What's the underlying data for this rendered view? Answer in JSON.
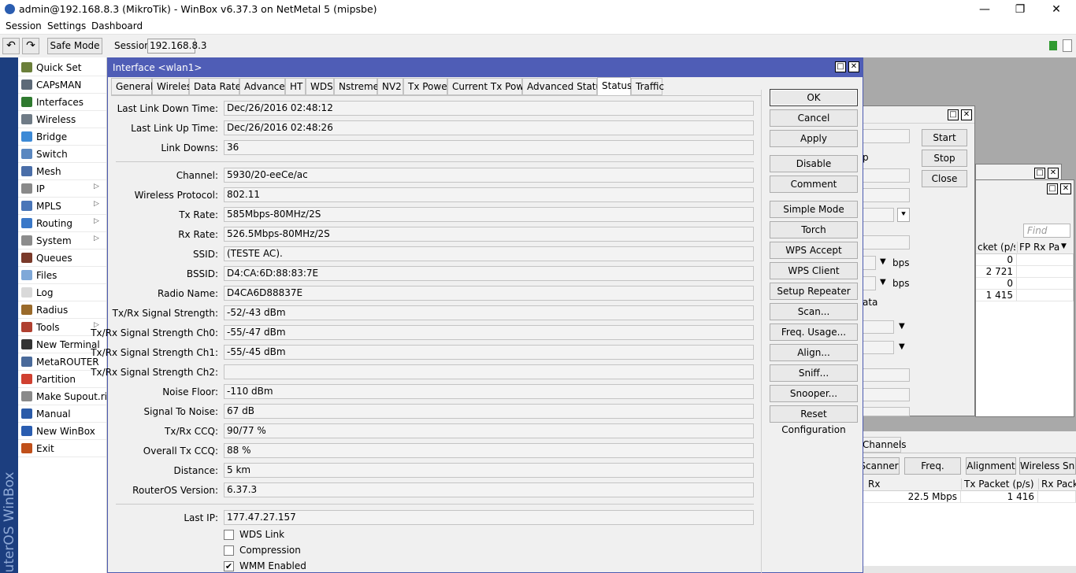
{
  "titlebar": {
    "title": "admin@192.168.8.3 (MikroTik) - WinBox v6.37.3 on NetMetal 5 (mipsbe)",
    "minimize": "—",
    "maximize": "❐",
    "close": "✕"
  },
  "menubar": {
    "items": [
      "Session",
      "Settings",
      "Dashboard"
    ]
  },
  "toolbar": {
    "undo_icon": "↶",
    "redo_icon": "↷",
    "safe_mode": "Safe Mode",
    "session_label": "Session:",
    "session_value": "192.168.8.3"
  },
  "vertical_brand": "RouterOS WinBox",
  "sidebar": {
    "items": [
      {
        "label": "Quick Set",
        "icon": "quick-set-icon",
        "color": "#6b7f3a",
        "submenu": false
      },
      {
        "label": "CAPsMAN",
        "icon": "capsman-icon",
        "color": "#5d6a78",
        "submenu": false
      },
      {
        "label": "Interfaces",
        "icon": "interfaces-icon",
        "color": "#2f7a2f",
        "submenu": false
      },
      {
        "label": "Wireless",
        "icon": "wireless-icon",
        "color": "#6f7b86",
        "submenu": false
      },
      {
        "label": "Bridge",
        "icon": "bridge-icon",
        "color": "#3d8ad6",
        "submenu": false
      },
      {
        "label": "Switch",
        "icon": "switch-icon",
        "color": "#5a87c0",
        "submenu": false
      },
      {
        "label": "Mesh",
        "icon": "mesh-icon",
        "color": "#4a6ea8",
        "submenu": false
      },
      {
        "label": "IP",
        "icon": "ip-icon",
        "color": "#8a8a8a",
        "submenu": true
      },
      {
        "label": "MPLS",
        "icon": "mpls-icon",
        "color": "#4a76b8",
        "submenu": true
      },
      {
        "label": "Routing",
        "icon": "routing-icon",
        "color": "#3a78c8",
        "submenu": true
      },
      {
        "label": "System",
        "icon": "system-icon",
        "color": "#8c8c8c",
        "submenu": true
      },
      {
        "label": "Queues",
        "icon": "queues-icon",
        "color": "#7a3a2a",
        "submenu": false
      },
      {
        "label": "Files",
        "icon": "files-icon",
        "color": "#7fa8d8",
        "submenu": false
      },
      {
        "label": "Log",
        "icon": "log-icon",
        "color": "#d9d9d9",
        "submenu": false
      },
      {
        "label": "Radius",
        "icon": "radius-icon",
        "color": "#9a6a2a",
        "submenu": false
      },
      {
        "label": "Tools",
        "icon": "tools-icon",
        "color": "#b04030",
        "submenu": true
      },
      {
        "label": "New Terminal",
        "icon": "terminal-icon",
        "color": "#333333",
        "submenu": false
      },
      {
        "label": "MetaROUTER",
        "icon": "metarouter-icon",
        "color": "#4a6a9a",
        "submenu": false
      },
      {
        "label": "Partition",
        "icon": "partition-icon",
        "color": "#d04030",
        "submenu": false
      },
      {
        "label": "Make Supout.rif",
        "icon": "supout-icon",
        "color": "#8a8a8a",
        "submenu": false
      },
      {
        "label": "Manual",
        "icon": "manual-icon",
        "color": "#2a5aa8",
        "submenu": false
      },
      {
        "label": "New WinBox",
        "icon": "winbox-icon",
        "color": "#2a5db0",
        "submenu": false
      },
      {
        "label": "Exit",
        "icon": "exit-icon",
        "color": "#c0501a",
        "submenu": false
      }
    ]
  },
  "dialog": {
    "title": "Interface <wlan1>",
    "tabs": [
      "General",
      "Wireless",
      "Data Rates",
      "Advanced",
      "HT",
      "WDS",
      "Nstreme",
      "NV2",
      "Tx Power",
      "Current Tx Power",
      "Advanced Status",
      "Status",
      "Traffic"
    ],
    "active_tab": "Status",
    "fields": [
      {
        "label": "Last Link Down Time:",
        "value": "Dec/26/2016 02:48:12"
      },
      {
        "label": "Last Link Up Time:",
        "value": "Dec/26/2016 02:48:26"
      },
      {
        "label": "Link Downs:",
        "value": "36"
      },
      {
        "label": "Channel:",
        "value": "5930/20-eeCe/ac"
      },
      {
        "label": "Wireless Protocol:",
        "value": "802.11"
      },
      {
        "label": "Tx Rate:",
        "value": "585Mbps-80MHz/2S"
      },
      {
        "label": "Rx Rate:",
        "value": "526.5Mbps-80MHz/2S"
      },
      {
        "label": "SSID:",
        "value": "(TESTE AC)."
      },
      {
        "label": "BSSID:",
        "value": "D4:CA:6D:88:83:7E"
      },
      {
        "label": "Radio Name:",
        "value": "D4CA6D88837E"
      },
      {
        "label": "Tx/Rx Signal Strength:",
        "value": "-52/-43 dBm"
      },
      {
        "label": "Tx/Rx Signal Strength Ch0:",
        "value": "-55/-47 dBm"
      },
      {
        "label": "Tx/Rx Signal Strength Ch1:",
        "value": "-55/-45 dBm"
      },
      {
        "label": "Tx/Rx Signal Strength Ch2:",
        "value": ""
      },
      {
        "label": "Noise Floor:",
        "value": "-110 dBm"
      },
      {
        "label": "Signal To Noise:",
        "value": "67 dB"
      },
      {
        "label": "Tx/Rx CCQ:",
        "value": "90/77 %"
      },
      {
        "label": "Overall Tx CCQ:",
        "value": "88 %"
      },
      {
        "label": "Distance:",
        "value": "5 km"
      },
      {
        "label": "RouterOS Version:",
        "value": "6.37.3"
      },
      {
        "label": "Last IP:",
        "value": "177.47.27.157"
      }
    ],
    "checkboxes": [
      {
        "label": "WDS Link",
        "checked": false
      },
      {
        "label": "Compression",
        "checked": false
      },
      {
        "label": "WMM Enabled",
        "checked": true
      }
    ],
    "buttons": [
      "OK",
      "Cancel",
      "Apply",
      "Disable",
      "Comment",
      "Simple Mode",
      "Torch",
      "WPS Accept",
      "WPS Client",
      "Setup Repeater",
      "Scan...",
      "Freq. Usage...",
      "Align...",
      "Sniff...",
      "Snooper...",
      "Reset Configuration"
    ]
  },
  "bg_window1": {
    "buttons": [
      "Start",
      "Stop",
      "Close"
    ],
    "partial_label": "p",
    "bps1": "bps",
    "bps2": "bps",
    "partial_data": "ata"
  },
  "bg_window2": {
    "find_placeholder": "Find",
    "columns": [
      "cket (p/s)",
      "FP Rx Pac"
    ],
    "rows": [
      "0",
      "2 721",
      "0",
      "1 415"
    ]
  },
  "bg_wireless": {
    "tab": "Channels",
    "buttons": [
      "Scanner",
      "Freq. Usage",
      "Alignment",
      "Wireless Snif"
    ],
    "columns": [
      "Rx",
      "Tx Packet (p/s)",
      "Rx Packe"
    ],
    "row": {
      "rx": "22.5 Mbps",
      "tx_packet": "1 416"
    }
  }
}
